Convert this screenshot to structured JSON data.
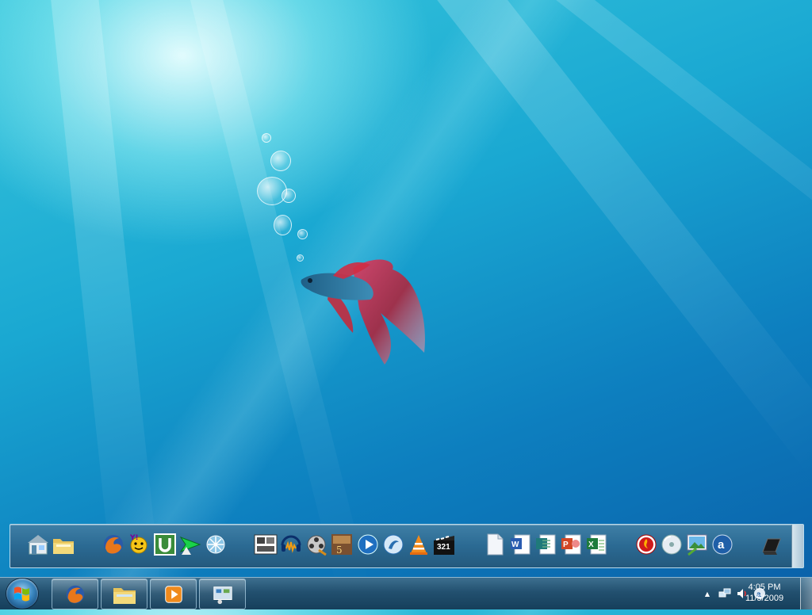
{
  "desktop": {
    "wallpaper": "betta-fish-underwater",
    "accent_colors": {
      "sky": "#37c6dc",
      "deep": "#0a5fa8",
      "fish_body": "#2a6f92",
      "fish_fin": "#d6283a"
    }
  },
  "dock": {
    "icons": [
      {
        "name": "home-icon",
        "title": "Home"
      },
      {
        "name": "folder-icon",
        "title": "Folder"
      },
      {
        "name": "firefox-icon",
        "title": "Firefox"
      },
      {
        "name": "yahoo-messenger-icon",
        "title": "Yahoo Messenger"
      },
      {
        "name": "utorrent-icon",
        "title": "uTorrent"
      },
      {
        "name": "download-manager-icon",
        "title": "Download Manager"
      },
      {
        "name": "network-tool-icon",
        "title": "Network Tool"
      },
      {
        "name": "windows-movie-maker-icon",
        "title": "Movie Maker"
      },
      {
        "name": "audio-editor-icon",
        "title": "Audio Editor"
      },
      {
        "name": "media-reel-icon",
        "title": "Media"
      },
      {
        "name": "video-editor-icon",
        "title": "Video Editor"
      },
      {
        "name": "media-player-icon",
        "title": "Media Player"
      },
      {
        "name": "realplayer-icon",
        "title": "RealPlayer"
      },
      {
        "name": "vlc-icon",
        "title": "VLC"
      },
      {
        "name": "media-player-classic-icon",
        "title": "Media Player Classic",
        "label": "321"
      },
      {
        "name": "document-icon",
        "title": "Document"
      },
      {
        "name": "word-icon",
        "title": "Word"
      },
      {
        "name": "publisher-icon",
        "title": "Publisher"
      },
      {
        "name": "powerpoint-icon",
        "title": "PowerPoint"
      },
      {
        "name": "excel-icon",
        "title": "Excel"
      },
      {
        "name": "nero-icon",
        "title": "Nero"
      },
      {
        "name": "cd-burner-icon",
        "title": "CD"
      },
      {
        "name": "picture-viewer-icon",
        "title": "Pictures"
      },
      {
        "name": "amazon-icon",
        "title": "Amazon"
      },
      {
        "name": "dock-settings-icon",
        "title": "Dock"
      }
    ]
  },
  "taskbar": {
    "start": {
      "name": "windows-start-icon"
    },
    "pinned": [
      {
        "name": "firefox-taskbar-icon"
      },
      {
        "name": "explorer-taskbar-icon"
      },
      {
        "name": "media-player-taskbar-icon"
      },
      {
        "name": "control-panel-taskbar-icon"
      }
    ],
    "tray": {
      "show_hidden": "▲",
      "icons": [
        "network-icon",
        "volume-icon",
        "amazon-tray-icon"
      ]
    },
    "clock": {
      "time": "4:05 PM",
      "date": "11/5/2009"
    }
  }
}
